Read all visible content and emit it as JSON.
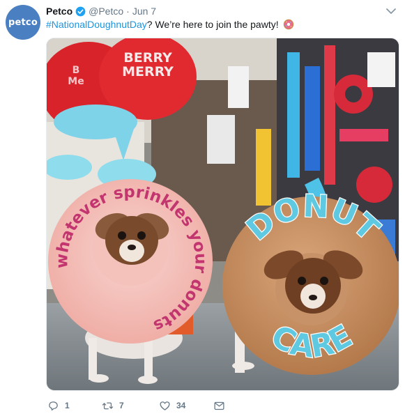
{
  "tweet": {
    "avatar_text": "petco",
    "name": "Petco",
    "handle": "@Petco",
    "separator": "·",
    "date": "Jun 7",
    "text_hashtag": "#NationalDoughnutDay",
    "text_body": "? We’re here to join the pawty!",
    "emoji": "donut-emoji"
  },
  "image": {
    "sign_line1": "BERRY",
    "sign_line2": "MERRY",
    "sign_side1": "B",
    "sign_side2": "Me",
    "donut_left_text": "whatever sprinkles your donuts",
    "donut_right_top": "DONUT",
    "donut_right_bottom": "CARE"
  },
  "actions": {
    "replies": "1",
    "retweets": "7",
    "likes": "34"
  },
  "colors": {
    "link": "#1b95e0",
    "muted": "#657786",
    "verified": "#1da1f2",
    "avatar": "#4a7fc1"
  }
}
